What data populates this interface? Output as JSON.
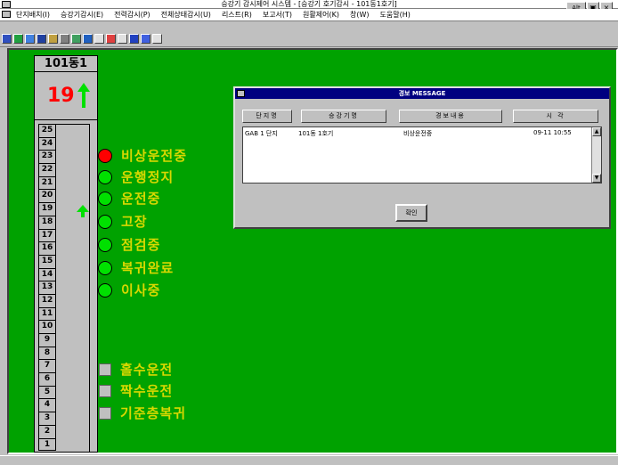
{
  "window": {
    "title": "승강기 감시제어 시스템 - [승강기 호기감시 - 101동1호기]",
    "min_label": "Alt",
    "max_label": "▣",
    "close_label": "×"
  },
  "menu": [
    "단지배치(I)",
    "승강기감시(E)",
    "전력감시(P)",
    "전체상태감시(U)",
    "리스트(R)",
    "보고서(T)",
    "원활제어(K)",
    "창(W)",
    "도움말(H)"
  ],
  "toolbar_icons": [
    "home-icon",
    "building-icon",
    "grid-icon",
    "monitor-icon",
    "chart-icon",
    "list-icon",
    "report-icon",
    "settings-icon",
    "camera-icon",
    "alarm-icon",
    "print-icon",
    "window-icon",
    "table-icon",
    "layout-icon"
  ],
  "car": {
    "name": "101동1",
    "floor": "19",
    "direction": "up",
    "floors": [
      "25",
      "24",
      "23",
      "22",
      "21",
      "20",
      "19",
      "18",
      "17",
      "16",
      "15",
      "14",
      "13",
      "12",
      "11",
      "10",
      "9",
      "8",
      "7",
      "6",
      "5",
      "4",
      "3",
      "2",
      "1"
    ]
  },
  "legend": [
    {
      "label": "비상운전중",
      "kind": "lamp",
      "color": "red"
    },
    {
      "label": "운행정지",
      "kind": "lamp",
      "color": "green"
    },
    {
      "label": "운전중",
      "kind": "lamp",
      "color": "green"
    },
    {
      "label": "고장",
      "kind": "lamp",
      "color": "green"
    },
    {
      "label": "점검중",
      "kind": "lamp",
      "color": "green"
    },
    {
      "label": "복귀완료",
      "kind": "lamp",
      "color": "green"
    },
    {
      "label": "이사중",
      "kind": "lamp",
      "color": "green"
    }
  ],
  "options": [
    {
      "label": "홀수운전"
    },
    {
      "label": "짝수운전"
    },
    {
      "label": "기준층복귀"
    }
  ],
  "dialog": {
    "title": "경보 MESSAGE",
    "columns": [
      "단지명",
      "승강기명",
      "경보내용",
      "시  각"
    ],
    "rows": [
      {
        "site": "GAB 1 단지",
        "elevator": "101동 1호기",
        "message": "비상운전중",
        "time": "09-11 10:55"
      }
    ],
    "ok_label": "확인"
  },
  "colors": {
    "background": "#00a200",
    "legend_text": "#d8d800",
    "floor_number": "#ff0000",
    "dialog_title": "#000080"
  }
}
